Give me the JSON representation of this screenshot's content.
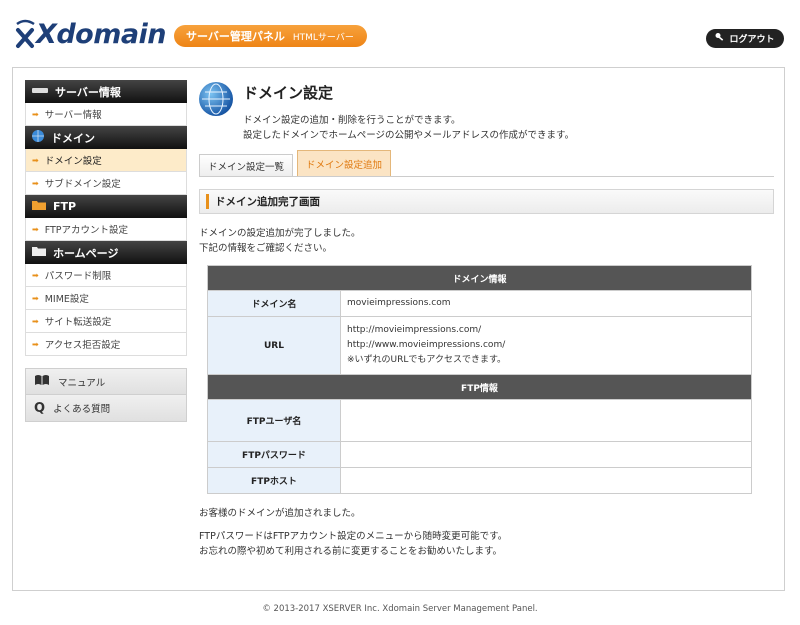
{
  "header": {
    "logo_text": "Xdomain",
    "panel_label": "サーバー管理パネル",
    "panel_sub": "HTMLサーバー",
    "logout_label": "ログアウト"
  },
  "sidebar": {
    "sections": [
      {
        "title": "サーバー情報",
        "icon": "server-icon",
        "items": [
          "サーバー情報"
        ]
      },
      {
        "title": "ドメイン",
        "icon": "globe-icon",
        "items": [
          "ドメイン設定",
          "サブドメイン設定"
        ]
      },
      {
        "title": "FTP",
        "icon": "folder-icon",
        "items": [
          "FTPアカウント設定"
        ]
      },
      {
        "title": "ホームページ",
        "icon": "folder-icon",
        "items": [
          "パスワード制限",
          "MIME設定",
          "サイト転送設定",
          "アクセス拒否設定"
        ]
      }
    ],
    "active_item": "ドメイン設定",
    "extras": [
      "マニュアル",
      "よくある質問"
    ]
  },
  "main": {
    "title": "ドメイン設定",
    "desc_line1": "ドメイン設定の追加・削除を行うことができます。",
    "desc_line2": "設定したドメインでホームページの公開やメールアドレスの作成ができます。",
    "tabs": [
      "ドメイン設定一覧",
      "ドメイン設定追加"
    ],
    "section_title": "ドメイン追加完了画面",
    "note_line1": "ドメインの設定追加が完了しました。",
    "note_line2": "下記の情報をご確認ください。",
    "domain_info_header": "ドメイン情報",
    "domain_label": "ドメイン名",
    "domain_value": "movieimpressions.com",
    "url_label": "URL",
    "url_line1": "http://movieimpressions.com/",
    "url_line2": "http://www.movieimpressions.com/",
    "url_line3": "※いずれのURLでもアクセスできます。",
    "ftp_info_header": "FTP情報",
    "ftp_user_label": "FTPユーザ名",
    "ftp_pass_label": "FTPパスワード",
    "ftp_host_label": "FTPホスト",
    "footer_line1": "お客様のドメインが追加されました。",
    "footer_line2": "FTPパスワードはFTPアカウント設定のメニューから随時変更可能です。",
    "footer_line3": "お忘れの際や初めて利用される前に変更することをお勧めいたします。"
  },
  "copyright": "© 2013-2017 XSERVER Inc.  Xdomain Server Management Panel.",
  "colors": {
    "accent": "#ee8416",
    "brand": "#1e3f78",
    "table_header": "#555555",
    "label_bg": "#e8f1fa"
  }
}
